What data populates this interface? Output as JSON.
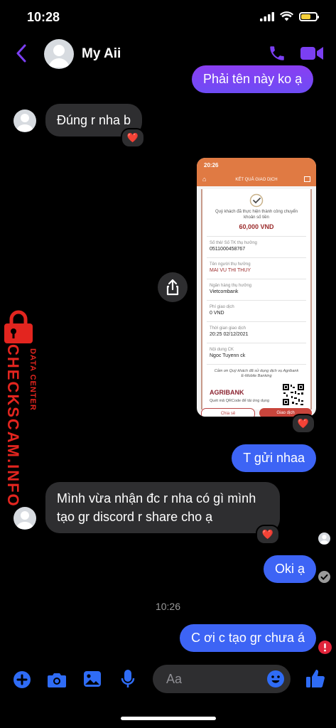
{
  "status_bar": {
    "time": "10:28",
    "battery_level_percent": 65
  },
  "header": {
    "contact_name": "My Aii"
  },
  "colors": {
    "accent": "#7b3ff2",
    "outgoing": "#3d64f5",
    "incoming": "#2e2e30",
    "error": "#e0243a",
    "watermark": "#e3251f"
  },
  "messages": {
    "m1": "Phải tên này ko ạ",
    "m2": "Đúng r nha b",
    "m2_reaction": "❤️",
    "m3_reaction": "❤️",
    "m4": "T gửi nhaa",
    "m5": "Mình vừa nhận đc r nha có gì mình tạo gr discord r share cho ạ",
    "m5_reaction": "❤️",
    "m6": "Oki ạ",
    "timestamp": "10:26",
    "m7": "C ơi c tạo gr chưa á"
  },
  "receipt": {
    "time": "20:26",
    "title": "KẾT QUẢ GIAO DỊCH",
    "success_text": "Quý khách đã thực hiện thành công chuyển khoản số tiền",
    "amount": "60,000 VND",
    "fields": [
      {
        "label": "Số thẻ/ Số TK thụ hưởng",
        "value": "0511000458767"
      },
      {
        "label": "Tên người thụ hưởng",
        "value": "MAI VU THI THUY"
      },
      {
        "label": "Ngân hàng thụ hưởng",
        "value": "Vietcombank"
      },
      {
        "label": "Phí giao dịch",
        "value": "0 VND"
      },
      {
        "label": "Thời gian giao dịch",
        "value": "20:25 02/12/2021"
      },
      {
        "label": "Nội dung CK",
        "value": "Ngoc Tuyenn ck"
      }
    ],
    "thanks": "Cảm ơn Quý khách đã sử dụng dịch vụ Agribank E-Mobile Banking",
    "brand": "AGRIBANK",
    "qr_caption": "Quét mã QRCode để tải ứng dụng",
    "btn_left": "Chia sẻ",
    "btn_right": "Giao dịch"
  },
  "watermark": {
    "top": "DATA CENTER",
    "main": "CHECKSCAM.INFO"
  },
  "composer": {
    "placeholder": "Aa"
  }
}
